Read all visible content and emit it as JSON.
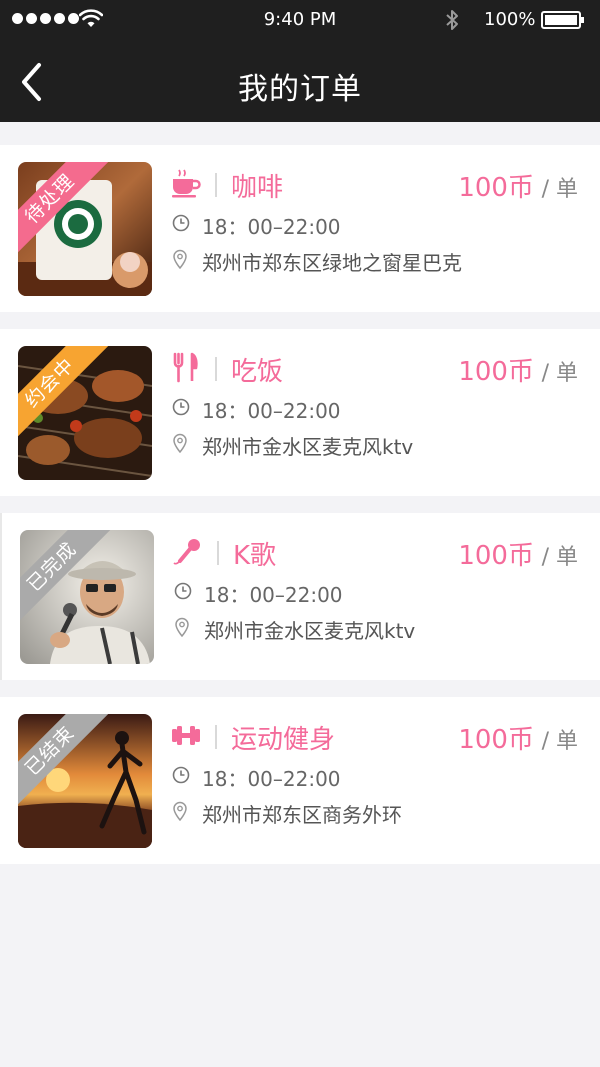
{
  "status_bar": {
    "time": "9:40 PM",
    "battery": "100%"
  },
  "nav": {
    "title": "我的订单",
    "back_icon": "chevron-left-icon"
  },
  "orders": [
    {
      "badge": "待处理",
      "badge_color": "#f46b8e",
      "category": "咖啡",
      "category_icon": "coffee-cup-icon",
      "price_amount": "100币",
      "price_unit": "/ 单",
      "time": "18：00–22:00",
      "location": "郑州市郑东区绿地之窗星巴克"
    },
    {
      "badge": "约会中",
      "badge_color": "#f7a431",
      "category": "吃饭",
      "category_icon": "fork-knife-icon",
      "price_amount": "100币",
      "price_unit": "/ 单",
      "time": "18：00–22:00",
      "location": "郑州市金水区麦克风ktv"
    },
    {
      "badge": "已完成",
      "badge_color": "#aaaaaa",
      "category": "K歌",
      "category_icon": "microphone-icon",
      "price_amount": "100币",
      "price_unit": "/ 单",
      "time": "18：00–22:00",
      "location": "郑州市金水区麦克风ktv"
    },
    {
      "badge": "已结束",
      "badge_color": "#aaaaaa",
      "category": "运动健身",
      "category_icon": "dumbbell-icon",
      "price_amount": "100币",
      "price_unit": "/ 单",
      "time": "18：00–22:00",
      "location": "郑州市郑东区商务外环"
    }
  ],
  "colors": {
    "accent": "#f46b9a",
    "header_bg": "#1f1f1f",
    "page_bg": "#f3f3f6"
  }
}
